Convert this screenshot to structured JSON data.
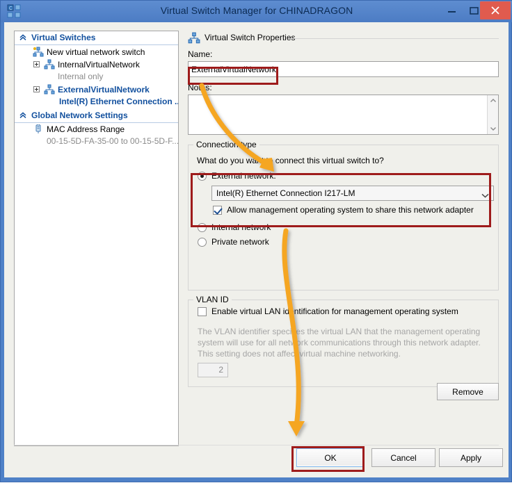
{
  "window": {
    "title": "Virtual Switch Manager for CHINADRAGON",
    "app_icon": "hyperv-switch-icon",
    "controls": {
      "minimize": "minimize-icon",
      "maximize": "maximize-icon",
      "close": "close-icon"
    },
    "accent_color": "#4f81c7",
    "close_color": "#e05b4e"
  },
  "tree": {
    "sections": [
      {
        "header": "Virtual Switches",
        "collapse_icon": "chevron-double-up-icon",
        "items": [
          {
            "label": "New virtual network switch",
            "icon": "new-virtual-switch-icon",
            "expandable": false,
            "selected": false,
            "sub": null
          },
          {
            "label": "InternalVirtualNetwork",
            "icon": "virtual-switch-icon",
            "expandable": true,
            "selected": false,
            "sub": "Internal only"
          },
          {
            "label": "ExternalVirtualNetwork",
            "icon": "virtual-switch-icon",
            "expandable": true,
            "selected": true,
            "sub": "Intel(R) Ethernet Connection ..."
          }
        ]
      },
      {
        "header": "Global Network Settings",
        "collapse_icon": "chevron-double-up-icon",
        "items": [
          {
            "label": "MAC Address Range",
            "icon": "mac-address-icon",
            "expandable": false,
            "selected": false,
            "sub": "00-15-5D-FA-35-00 to 00-15-5D-F..."
          }
        ]
      }
    ]
  },
  "properties": {
    "group_title": "Virtual Switch Properties",
    "group_icon": "virtual-switch-icon",
    "name_label": "Name:",
    "name_value": "ExternalVirtualNetwork",
    "notes_label": "Notes:",
    "notes_value": "",
    "notes_placeholder": ""
  },
  "connection_type": {
    "legend": "Connection type",
    "question": "What do you want to connect this virtual switch to?",
    "external": {
      "label": "External network:",
      "selected": true,
      "adapter_value": "Intel(R) Ethernet Connection I217-LM",
      "adapter_options": [
        "Intel(R) Ethernet Connection I217-LM"
      ],
      "share_label": "Allow management operating system to share this network adapter",
      "share_checked": true
    },
    "internal": {
      "label": "Internal network",
      "selected": false
    },
    "private": {
      "label": "Private network",
      "selected": false
    }
  },
  "vlan": {
    "legend": "VLAN ID",
    "enable_label": "Enable virtual LAN identification for management operating system",
    "enable_checked": false,
    "description": "The VLAN identifier specifies the virtual LAN that the management operating system will use for all network communications through this network adapter. This setting does not affect virtual machine networking.",
    "value": "2",
    "disabled": true
  },
  "buttons": {
    "remove": "Remove",
    "ok": "OK",
    "cancel": "Cancel",
    "apply": "Apply"
  },
  "annotations": {
    "highlight_color": "#9e1b1b",
    "arrow_color": "#f5a623",
    "boxes": [
      "name-field-highlight",
      "external-network-highlight",
      "ok-button-highlight"
    ],
    "arrows": [
      "arrow-name-to-connection-type",
      "arrow-external-to-ok"
    ]
  }
}
